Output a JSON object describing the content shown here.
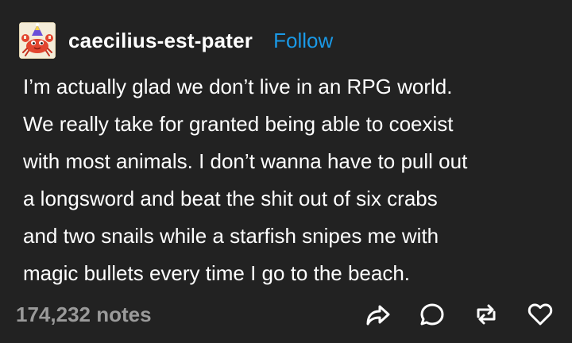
{
  "post": {
    "username": "caecilius-est-pater",
    "follow_label": "Follow",
    "avatar_icon": "crab-avatar-icon",
    "body_lines": [
      "I’m actually glad we don’t live in an RPG world.",
      "We really take for granted being able to coexist",
      "with most animals. I don’t wanna have to pull out",
      "a longsword and beat the shit out of six crabs",
      "and two snails while a starfish snipes me with",
      "magic bullets every time I go to the beach."
    ],
    "notes": "174,232 notes"
  },
  "icons": {
    "share": "share-icon",
    "reply": "reply-icon",
    "reblog": "reblog-icon",
    "like": "heart-icon"
  },
  "colors": {
    "background": "#222222",
    "text": "#ffffff",
    "follow": "#1a99e6",
    "muted": "#9a9a9a"
  }
}
